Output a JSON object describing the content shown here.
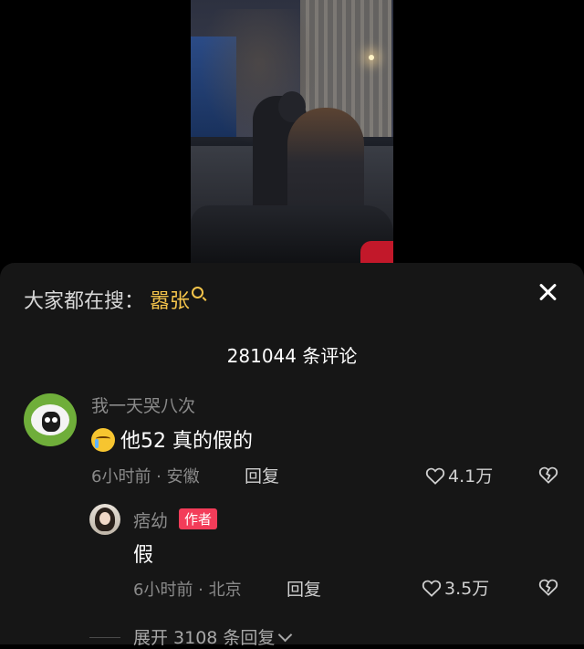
{
  "search": {
    "prefix": "大家都在搜：",
    "keyword": "嚣张"
  },
  "comments_count": "281044 条评论",
  "comments": [
    {
      "username": "我一天哭八次",
      "text": "他52 真的假的",
      "meta": "6小时前 · 安徽",
      "reply_label": "回复",
      "likes": "4.1万"
    }
  ],
  "reply": {
    "username": "痞幼",
    "badge": "作者",
    "text": "假",
    "meta": "6小时前 · 北京",
    "reply_label": "回复",
    "likes": "3.5万"
  },
  "expand_label": "展开 3108 条回复",
  "colors": {
    "sheet_bg": "#161616",
    "keyword": "#f6c54b",
    "author_badge": "#f33c59"
  }
}
